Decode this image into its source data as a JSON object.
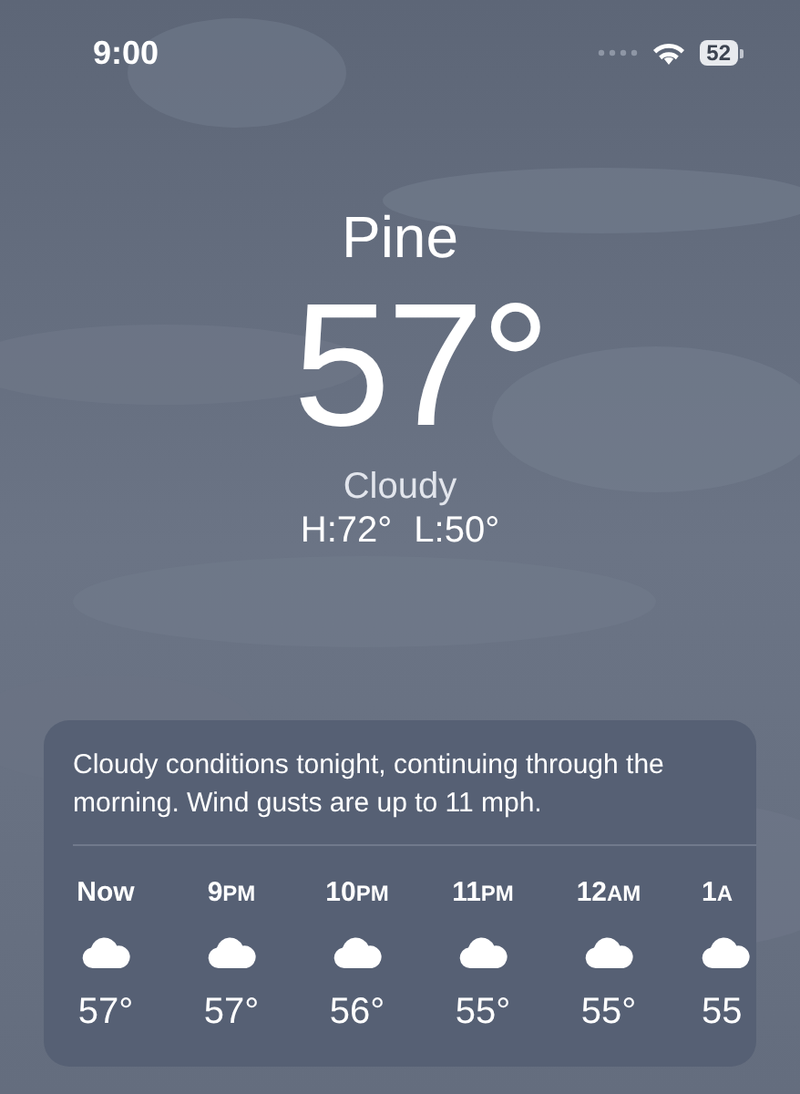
{
  "status_bar": {
    "time": "9:00",
    "battery": "52"
  },
  "location": {
    "city": "Pine",
    "temperature": "57°",
    "condition": "Cloudy",
    "high": "H:72°",
    "low": "L:50°"
  },
  "forecast": {
    "summary": "Cloudy conditions tonight, continuing through the morning. Wind gusts are up to 11 mph.",
    "hours": [
      {
        "hour": "Now",
        "temperature": "57°"
      },
      {
        "hour": "9",
        "suffix": "PM",
        "temperature": "57°"
      },
      {
        "hour": "10",
        "suffix": "PM",
        "temperature": "56°"
      },
      {
        "hour": "11",
        "suffix": "PM",
        "temperature": "55°"
      },
      {
        "hour": "12",
        "suffix": "AM",
        "temperature": "55°"
      },
      {
        "hour": "1",
        "suffix": "A",
        "temperature": "55"
      }
    ]
  }
}
